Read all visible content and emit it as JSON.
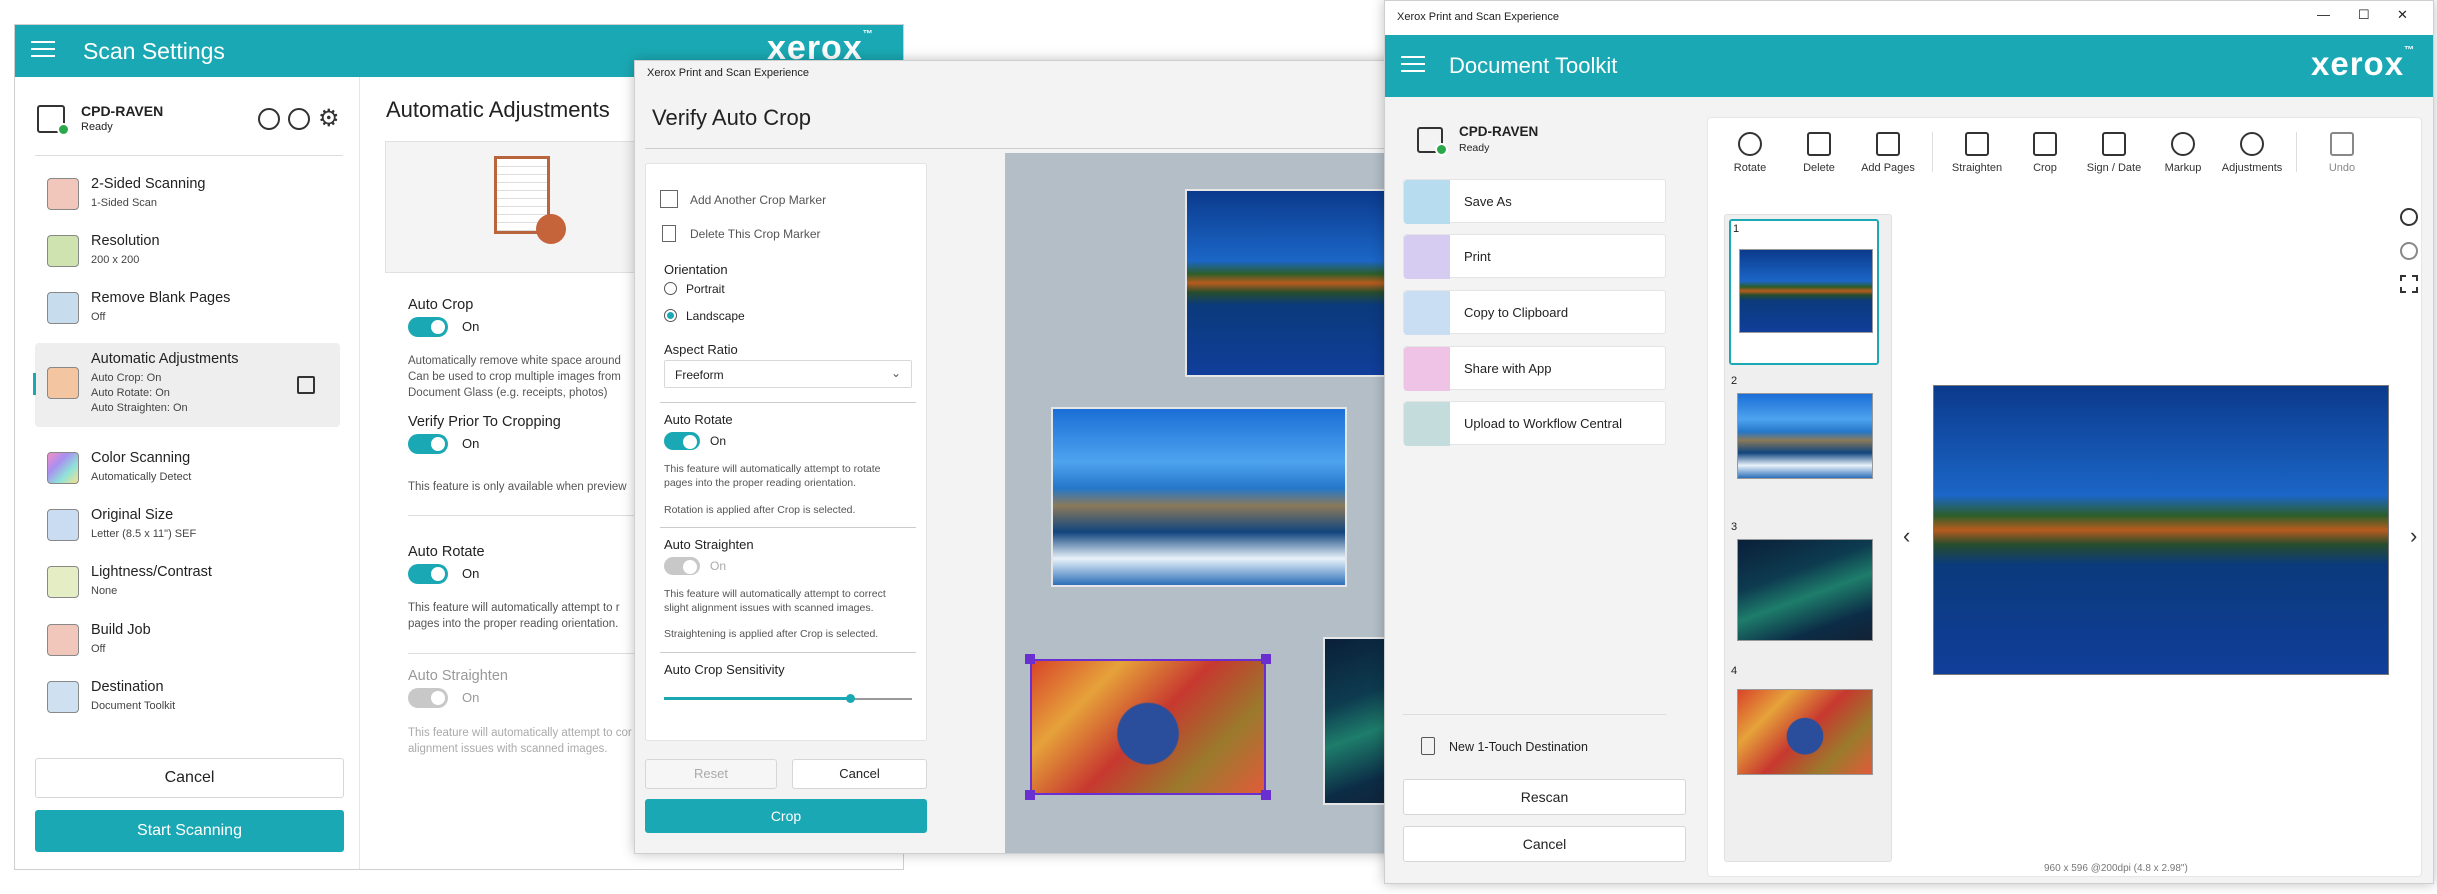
{
  "scan_settings": {
    "title": "Scan Settings",
    "brand": "xerox",
    "brand_mark": "™",
    "device": {
      "name": "CPD-RAVEN",
      "status": "Ready"
    },
    "items": [
      {
        "title": "2-Sided Scanning",
        "sub": "1-Sided Scan",
        "icon": "two-sided-icon",
        "color": "#e89a86"
      },
      {
        "title": "Resolution",
        "sub": "200 x 200",
        "icon": "resolution-grid-icon",
        "color": "#a7c77a"
      },
      {
        "title": "Remove Blank Pages",
        "sub": "Off",
        "icon": "blank-page-icon",
        "color": "#8ab4d4"
      },
      {
        "title": "Automatic Adjustments",
        "sub": "Auto Crop: On\nAuto Rotate: On\nAuto Straighten: On",
        "icon": "auto-adjust-icon",
        "color": "#e7a06c"
      },
      {
        "title": "Color Scanning",
        "sub": "Automatically Detect",
        "icon": "color-spectrum-icon",
        "color": "#d18ee0"
      },
      {
        "title": "Original Size",
        "sub": "Letter (8.5 x 11\") SEF",
        "icon": "original-size-icon",
        "color": "#8fb5e1"
      },
      {
        "title": "Lightness/Contrast",
        "sub": "None",
        "icon": "brightness-icon",
        "color": "#c7d98a"
      },
      {
        "title": "Build Job",
        "sub": "Off",
        "icon": "build-job-icon",
        "color": "#e89a86"
      },
      {
        "title": "Destination",
        "sub": "Document Toolkit",
        "icon": "destination-icon",
        "color": "#9ec0e0"
      }
    ],
    "cancel": "Cancel",
    "start": "Start Scanning",
    "panel": {
      "title": "Automatic Adjustments",
      "auto_crop": "Auto Crop",
      "auto_crop_state": "On",
      "auto_crop_desc": "Automatically remove white space around\nCan be used to crop multiple images from\nDocument Glass (e.g. receipts, photos)",
      "verify": "Verify Prior To Cropping",
      "verify_state": "On",
      "verify_note": "This feature is only available when preview",
      "auto_rotate": "Auto Rotate",
      "auto_rotate_state": "On",
      "auto_rotate_desc": "This feature will automatically attempt to r\npages into the proper reading orientation.",
      "auto_straighten": "Auto Straighten",
      "auto_straighten_state": "On",
      "auto_straighten_desc": "This feature will automatically attempt to cor\nalignment issues with scanned images."
    }
  },
  "verify_crop": {
    "window_title": "Xerox Print and Scan Experience",
    "title": "Verify Auto Crop",
    "add_marker": "Add Another Crop Marker",
    "delete_marker": "Delete This Crop Marker",
    "orientation": "Orientation",
    "portrait": "Portrait",
    "landscape": "Landscape",
    "orientation_selected": "Landscape",
    "aspect": "Aspect Ratio",
    "aspect_value": "Freeform",
    "auto_rotate": "Auto Rotate",
    "auto_rotate_state": "On",
    "auto_rotate_desc": "This feature will automatically attempt to rotate\npages into the proper reading orientation.",
    "auto_rotate_note": "Rotation is applied after Crop is selected.",
    "auto_straighten": "Auto Straighten",
    "auto_straighten_state": "On",
    "auto_straighten_desc": "This feature will automatically attempt to correct\nslight alignment issues with scanned images.",
    "auto_straighten_note": "Straightening is applied after Crop is selected.",
    "sensitivity": "Auto Crop Sensitivity",
    "sensitivity_level": 0.75,
    "reset": "Reset",
    "cancel": "Cancel",
    "crop": "Crop"
  },
  "toolkit": {
    "window_title": "Xerox Print and Scan Experience",
    "title": "Document Toolkit",
    "brand": "xerox",
    "brand_mark": "™",
    "win_controls": [
      "—",
      "☐",
      "✕"
    ],
    "device": {
      "name": "CPD-RAVEN",
      "status": "Ready"
    },
    "actions": [
      {
        "label": "Save As",
        "icon": "save-as-icon",
        "color": "#8ec6e6"
      },
      {
        "label": "Print",
        "icon": "print-icon",
        "color": "#c7b8ec"
      },
      {
        "label": "Copy to Clipboard",
        "icon": "clipboard-icon",
        "color": "#a9c9ee"
      },
      {
        "label": "Share with App",
        "icon": "share-icon",
        "color": "#e8a6d8"
      },
      {
        "label": "Upload to Workflow Central",
        "icon": "workflow-icon",
        "color": "#9ec4c4"
      }
    ],
    "new_dest": "New 1-Touch Destination",
    "rescan": "Rescan",
    "cancel": "Cancel",
    "toolbar": [
      {
        "label": "Rotate",
        "icon": "rotate-icon"
      },
      {
        "label": "Delete",
        "icon": "trash-icon"
      },
      {
        "label": "Add Pages",
        "icon": "add-pages-icon"
      },
      {
        "label": "Straighten",
        "icon": "straighten-icon"
      },
      {
        "label": "Crop",
        "icon": "crop-icon"
      },
      {
        "label": "Sign / Date",
        "icon": "sign-icon"
      },
      {
        "label": "Markup",
        "icon": "markup-icon"
      },
      {
        "label": "Adjustments",
        "icon": "adjustments-icon"
      },
      {
        "label": "Undo",
        "icon": "undo-icon"
      }
    ],
    "pages": [
      "1",
      "2",
      "3",
      "4"
    ],
    "selected_page": "1",
    "status": "960 x 596 @200dpi (4.8 x 2.98\")"
  }
}
